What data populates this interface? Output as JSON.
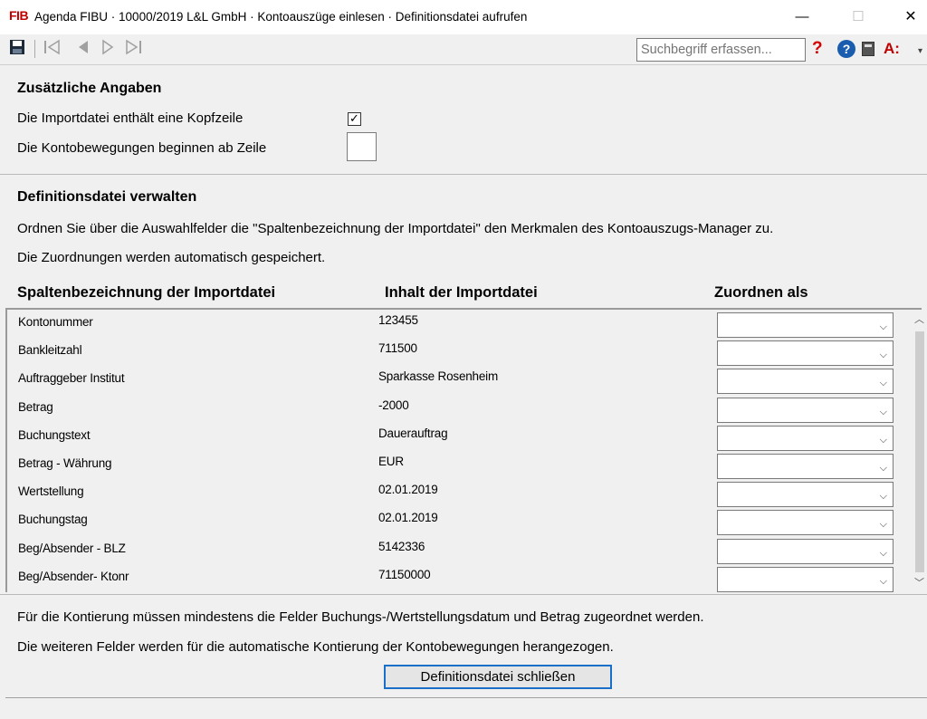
{
  "window": {
    "logo": "FIB",
    "title": "Agenda FIBU · 10000/2019 L&L GmbH · Kontoauszüge einlesen · Definitionsdatei aufrufen",
    "minimize": "—",
    "maximize": "☐",
    "close": "✕"
  },
  "toolbar": {
    "search_placeholder": "Suchbegriff erfassen...",
    "question": "?",
    "help": "?",
    "a_label": "A:"
  },
  "zusatz": {
    "heading": "Zusätzliche Angaben",
    "kopfzeile_label": "Die Importdatei enthält eine Kopfzeile",
    "kopfzeile_checked": true,
    "zeile_label": "Die Kontobewegungen beginnen ab Zeile",
    "zeile_value": ""
  },
  "verwalten": {
    "heading": "Definitionsdatei verwalten",
    "info1": "Ordnen Sie über die Auswahlfelder die \"Spaltenbezeichnung der Importdatei\" den Merkmalen des Kontoauszugs-Manager zu.",
    "info2": "Die Zuordnungen werden automatisch gespeichert."
  },
  "table": {
    "headers": [
      "Spaltenbezeichnung der Importdatei",
      "Inhalt der Importdatei",
      "Zuordnen als"
    ],
    "rows": [
      {
        "column": "Kontonummer",
        "value": "123455",
        "assign": ""
      },
      {
        "column": "Bankleitzahl",
        "value": "711500",
        "assign": ""
      },
      {
        "column": "Auftraggeber Institut",
        "value": "Sparkasse Rosenheim",
        "assign": ""
      },
      {
        "column": "Betrag",
        "value": "-2000",
        "assign": ""
      },
      {
        "column": "Buchungstext",
        "value": "Dauerauftrag",
        "assign": ""
      },
      {
        "column": "Betrag - Währung",
        "value": "EUR",
        "assign": ""
      },
      {
        "column": "Wertstellung",
        "value": "02.01.2019",
        "assign": ""
      },
      {
        "column": "Buchungstag",
        "value": "02.01.2019",
        "assign": ""
      },
      {
        "column": "Beg/Absender - BLZ",
        "value": "5142336",
        "assign": ""
      },
      {
        "column": "Beg/Absender- Ktonr",
        "value": "71150000",
        "assign": ""
      }
    ]
  },
  "footer": {
    "note1": "Für die Kontierung müssen mindestens die Felder Buchungs-/Wertstellungsdatum und Betrag zugeordnet werden.",
    "note2": "Die weiteren Felder werden für die automatische Kontierung der Kontobewegungen herangezogen.",
    "close_button": "Definitionsdatei schließen"
  }
}
